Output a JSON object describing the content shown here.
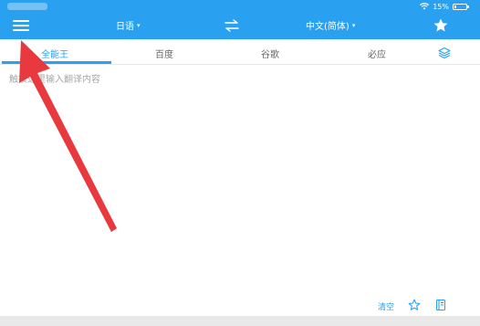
{
  "status_bar": {
    "battery_text": "15%"
  },
  "top_bar": {
    "source_language": "日语",
    "target_language": "中文(简体)",
    "caret": "▾",
    "accent_color": "#2aa1f0"
  },
  "tabs": [
    {
      "label": "全能王",
      "active": true
    },
    {
      "label": "百度",
      "active": false
    },
    {
      "label": "谷歌",
      "active": false
    },
    {
      "label": "必应",
      "active": false
    }
  ],
  "input": {
    "placeholder": "触摸这里输入翻译内容",
    "value": ""
  },
  "tools": {
    "clear_label": "清空"
  },
  "icons": {
    "menu": "menu-icon",
    "swap": "swap-languages-icon",
    "star": "star-icon",
    "layers": "layers-icon",
    "favorite": "star-outline-icon",
    "book": "book-icon",
    "wifi": "wifi-icon",
    "battery": "battery-icon"
  },
  "annotation": {
    "color": "#e8393f"
  }
}
